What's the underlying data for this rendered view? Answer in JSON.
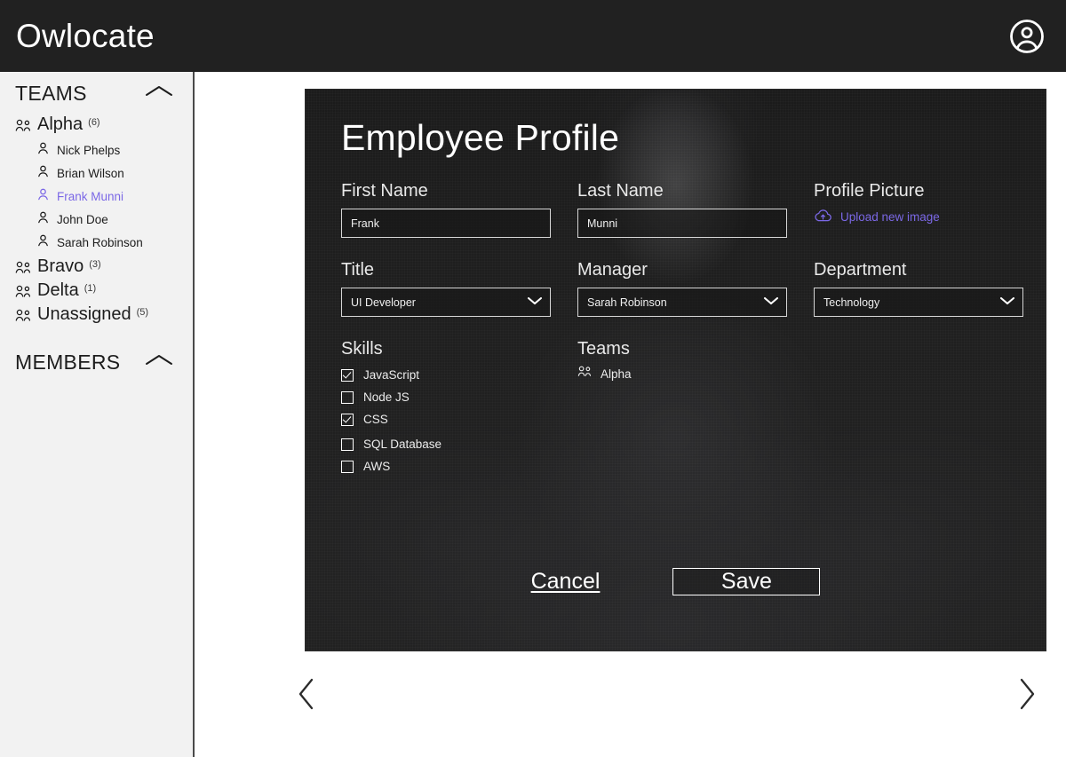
{
  "header": {
    "app_title": "Owlocate",
    "account_icon": "account-circle-icon"
  },
  "sidebar": {
    "teams_section": {
      "title": "TEAMS",
      "collapse_icon": "chevron-up-icon",
      "teams": [
        {
          "name": "Alpha",
          "count": "(6)",
          "icon": "group-icon",
          "members": [
            {
              "name": "Nick Phelps",
              "icon": "person-icon",
              "active": false
            },
            {
              "name": "Brian Wilson",
              "icon": "person-icon",
              "active": false
            },
            {
              "name": "Frank Munni",
              "icon": "person-icon",
              "active": true
            },
            {
              "name": "John Doe",
              "icon": "person-icon",
              "active": false
            },
            {
              "name": "Sarah Robinson",
              "icon": "person-icon",
              "active": false
            }
          ]
        },
        {
          "name": "Bravo",
          "count": "(3)",
          "icon": "group-icon",
          "members": []
        },
        {
          "name": "Delta",
          "count": "(1)",
          "icon": "group-icon",
          "members": []
        },
        {
          "name": "Unassigned",
          "count": "(5)",
          "icon": "group-icon",
          "members": []
        }
      ]
    },
    "members_section": {
      "title": "MEMBERS",
      "collapse_icon": "chevron-up-icon"
    }
  },
  "profile_card": {
    "title": "Employee Profile",
    "fields": {
      "first_name": {
        "label": "First Name",
        "value": "Frank",
        "placeholder": "First Name"
      },
      "last_name": {
        "label": "Last Name",
        "value": "Munni",
        "placeholder": "Last Name"
      },
      "profile_picture": {
        "label": "Profile Picture",
        "upload_label": "Upload new image",
        "upload_icon": "cloud-upload-icon"
      },
      "title": {
        "label": "Title",
        "value": "UI Developer",
        "chevron_icon": "chevron-down-icon",
        "options": [
          "UI Developer"
        ]
      },
      "manager": {
        "label": "Manager",
        "value": "Sarah Robinson",
        "chevron_icon": "chevron-down-icon",
        "options": [
          "Sarah Robinson"
        ]
      },
      "department": {
        "label": "Department",
        "value": "Technology",
        "chevron_icon": "chevron-down-icon",
        "options": [
          "Technology"
        ]
      }
    },
    "skills": {
      "label": "Skills",
      "items": [
        {
          "name": "JavaScript",
          "checked": true
        },
        {
          "name": "Node JS",
          "checked": false
        },
        {
          "name": "CSS",
          "checked": true
        },
        {
          "name": "SQL Database",
          "checked": false
        },
        {
          "name": "AWS",
          "checked": false
        }
      ]
    },
    "teams": {
      "label": "Teams",
      "items": [
        {
          "name": "Alpha",
          "icon": "group-icon"
        }
      ]
    },
    "actions": {
      "cancel_label": "Cancel",
      "save_label": "Save"
    }
  },
  "pager": {
    "prev_icon": "chevron-left-icon",
    "next_icon": "chevron-right-icon"
  },
  "colors": {
    "accent_purple": "#7b68e6",
    "header_bg": "#212121",
    "card_bg": "#1e1e1e",
    "sidebar_bg": "#f2f2f2"
  }
}
